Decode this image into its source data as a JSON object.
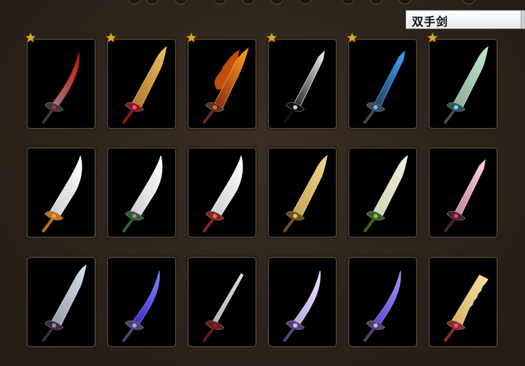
{
  "category_select": {
    "selected": "双手剑"
  },
  "colors": {
    "panel_bg": "#2c241b",
    "slot_border": "#4a3d2e",
    "star": "#d8a928"
  },
  "weapons": [
    {
      "icon": "crimson-scimitar-icon",
      "starred": true,
      "blade": "#8a8a8a",
      "edge": "#c41818",
      "hilt": "#3a3a3a",
      "gem": "#d02030",
      "shape": "curve"
    },
    {
      "icon": "flame-gold-greatsword-icon",
      "starred": true,
      "blade": "#b07030",
      "edge": "#e8c060",
      "hilt": "#8a1818",
      "gem": "#ff40a0",
      "shape": "broad"
    },
    {
      "icon": "inferno-blade-icon",
      "starred": true,
      "blade": "#802010",
      "edge": "#ffa020",
      "hilt": "#5a3020",
      "gem": "#ff6020",
      "shape": "fire"
    },
    {
      "icon": "shadow-blade-icon",
      "starred": true,
      "blade": "#1a1a1a",
      "edge": "#f0f0f0",
      "hilt": "#101010",
      "gem": "#d0d0d0",
      "shape": "straight"
    },
    {
      "icon": "azure-runesword-icon",
      "starred": true,
      "blade": "#2a3a4a",
      "edge": "#40a0ff",
      "hilt": "#3a4a5a",
      "gem": "#60c0ff",
      "shape": "straight"
    },
    {
      "icon": "jade-spirit-blade-icon",
      "starred": true,
      "blade": "#8aa890",
      "edge": "#c0e8d0",
      "hilt": "#3a5050",
      "gem": "#60e0ff",
      "shape": "broad"
    },
    {
      "icon": "golden-cleaver-icon",
      "starred": false,
      "blade": "#c8c8d0",
      "edge": "#ffffff",
      "hilt": "#c07020",
      "gem": "#ffa030",
      "shape": "cleaver"
    },
    {
      "icon": "verdant-cleaver-icon",
      "starred": false,
      "blade": "#c8c8d0",
      "edge": "#ffffff",
      "hilt": "#2a6040",
      "gem": "#c08050",
      "shape": "cleaver"
    },
    {
      "icon": "crimson-cleaver-icon",
      "starred": false,
      "blade": "#c8c8d0",
      "edge": "#ffffff",
      "hilt": "#8a2020",
      "gem": "#c08050",
      "shape": "cleaver"
    },
    {
      "icon": "amber-greatsword-icon",
      "starred": false,
      "blade": "#c0a050",
      "edge": "#f0d890",
      "hilt": "#705020",
      "gem": "#f0c040",
      "shape": "broad"
    },
    {
      "icon": "emerald-greatsword-icon",
      "starred": false,
      "blade": "#d0d0b0",
      "edge": "#f0f0e0",
      "hilt": "#3a6020",
      "gem": "#80c040",
      "shape": "broad"
    },
    {
      "icon": "rose-crystal-blade-icon",
      "starred": false,
      "blade": "#c08090",
      "edge": "#ffd0e0",
      "hilt": "#4a2030",
      "gem": "#e04060",
      "shape": "straight"
    },
    {
      "icon": "steel-demon-blade-icon",
      "starred": false,
      "blade": "#9098a8",
      "edge": "#d8e0f0",
      "hilt": "#3a2a40",
      "gem": "#b08090",
      "shape": "broad"
    },
    {
      "icon": "violet-scimitar-icon",
      "starred": false,
      "blade": "#3020c0",
      "edge": "#8080ff",
      "hilt": "#504070",
      "gem": "#a0a0ff",
      "shape": "curve"
    },
    {
      "icon": "katana-icon",
      "starred": false,
      "blade": "#a8a8a8",
      "edge": "#e0e0e0",
      "hilt": "#6a1818",
      "gem": "#8a2020",
      "shape": "thin"
    },
    {
      "icon": "amethyst-scimitar-icon",
      "starred": false,
      "blade": "#b0a0e0",
      "edge": "#f0e0ff",
      "hilt": "#5a4080",
      "gem": "#d0c0ff",
      "shape": "curve"
    },
    {
      "icon": "indigo-scimitar-icon",
      "starred": false,
      "blade": "#5040d0",
      "edge": "#a090ff",
      "hilt": "#504070",
      "gem": "#c0b0ff",
      "shape": "curve"
    },
    {
      "icon": "golden-sawblade-icon",
      "starred": false,
      "blade": "#d0b060",
      "edge": "#f8e0a0",
      "hilt": "#8a3020",
      "gem": "#ff40a0",
      "shape": "saw"
    }
  ]
}
